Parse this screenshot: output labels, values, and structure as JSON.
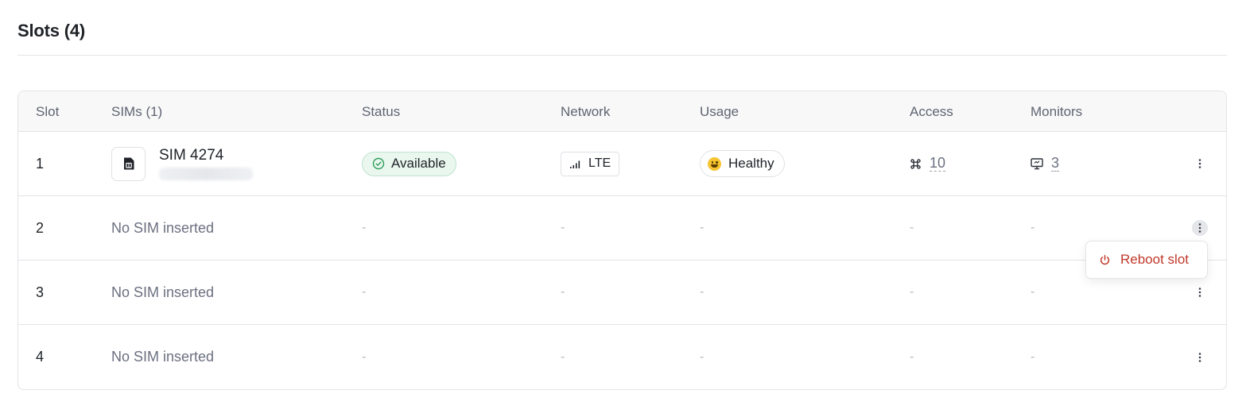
{
  "section": {
    "title": "Slots (4)"
  },
  "table": {
    "headers": {
      "slot": "Slot",
      "sims": "SIMs (1)",
      "status": "Status",
      "network": "Network",
      "usage": "Usage",
      "access": "Access",
      "monitors": "Monitors"
    },
    "rows": [
      {
        "slot": "1",
        "sim_name": "SIM 4274",
        "status": "Available",
        "network": "LTE",
        "usage": "Healthy",
        "access": "10",
        "monitors": "3"
      },
      {
        "slot": "2",
        "sim_empty": "No SIM inserted",
        "status": "-",
        "network": "-",
        "usage": "-",
        "access": "-",
        "monitors": "-"
      },
      {
        "slot": "3",
        "sim_empty": "No SIM inserted",
        "status": "-",
        "network": "-",
        "usage": "-",
        "access": "-",
        "monitors": "-"
      },
      {
        "slot": "4",
        "sim_empty": "No SIM inserted",
        "status": "-",
        "network": "-",
        "usage": "-",
        "access": "-",
        "monitors": "-"
      }
    ]
  },
  "context_menu": {
    "reboot_label": "Reboot slot"
  },
  "icons": {
    "sim": "sim-card-icon",
    "status": "check-circle-icon",
    "network": "signal-bars-icon",
    "usage": "smiley-emoji-icon",
    "access": "command-icon",
    "monitors": "monitor-icon",
    "menu": "kebab-menu-icon",
    "reboot": "power-icon"
  },
  "colors": {
    "available_bg": "#eaf7ef",
    "available_border": "#bfe3cc",
    "available_icon": "#2e9e5b",
    "danger": "#c0392b"
  }
}
